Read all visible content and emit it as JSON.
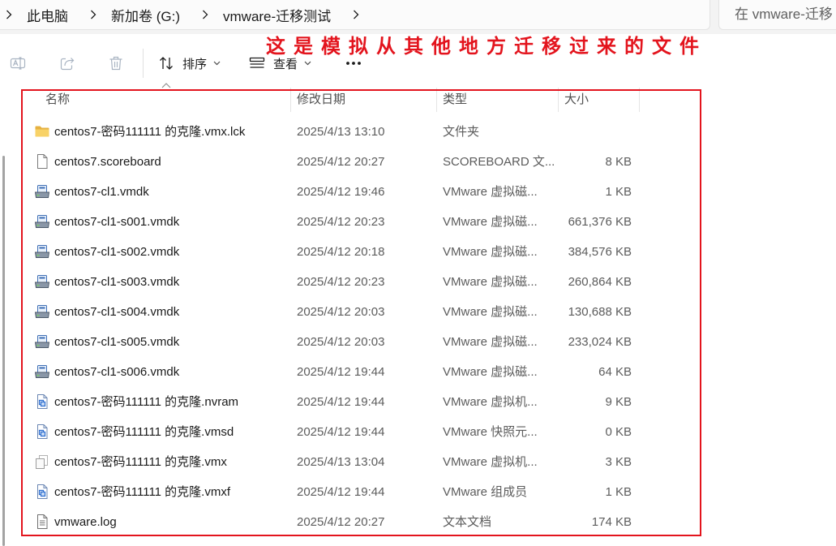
{
  "address_bar": {
    "crumbs": [
      "此电脑",
      "新加卷 (G:)",
      "vmware-迁移测试"
    ],
    "separator_icon": "chevron-right-icon"
  },
  "search": {
    "placeholder": "在 vmware-迁移"
  },
  "toolbar": {
    "rename": {
      "icon": "rename-icon",
      "disabled": true
    },
    "share": {
      "icon": "share-icon",
      "disabled": true
    },
    "delete": {
      "icon": "delete-icon",
      "disabled": true
    },
    "sort": {
      "icon": "sort-icon",
      "label": "排序",
      "dropdown_icon": "chevron-down-icon"
    },
    "view": {
      "icon": "view-list-icon",
      "label": "查看",
      "dropdown_icon": "chevron-down-icon"
    },
    "more": {
      "icon": "more-options-icon"
    }
  },
  "annotation": {
    "text": "这是模拟从其他地方迁移过来的文件",
    "color": "#e3141d",
    "box_color": "#e3141d"
  },
  "file_list": {
    "sort_indicator_icon": "chevron-up-icon",
    "columns": {
      "name": "名称",
      "modified": "修改日期",
      "type": "类型",
      "size": "大小"
    },
    "files": [
      {
        "icon": "folder-icon",
        "name": "centos7-密码111111 的克隆.vmx.lck",
        "modified": "2025/4/13 13:10",
        "type": "文件夹",
        "size": ""
      },
      {
        "icon": "document-icon",
        "name": "centos7.scoreboard",
        "modified": "2025/4/12 20:27",
        "type": "SCOREBOARD 文...",
        "size": "8 KB"
      },
      {
        "icon": "virtual-disk-icon",
        "name": "centos7-cl1.vmdk",
        "modified": "2025/4/12 19:46",
        "type": "VMware 虚拟磁...",
        "size": "1 KB"
      },
      {
        "icon": "virtual-disk-icon",
        "name": "centos7-cl1-s001.vmdk",
        "modified": "2025/4/12 20:23",
        "type": "VMware 虚拟磁...",
        "size": "661,376 KB"
      },
      {
        "icon": "virtual-disk-icon",
        "name": "centos7-cl1-s002.vmdk",
        "modified": "2025/4/12 20:18",
        "type": "VMware 虚拟磁...",
        "size": "384,576 KB"
      },
      {
        "icon": "virtual-disk-icon",
        "name": "centos7-cl1-s003.vmdk",
        "modified": "2025/4/12 20:23",
        "type": "VMware 虚拟磁...",
        "size": "260,864 KB"
      },
      {
        "icon": "virtual-disk-icon",
        "name": "centos7-cl1-s004.vmdk",
        "modified": "2025/4/12 20:03",
        "type": "VMware 虚拟磁...",
        "size": "130,688 KB"
      },
      {
        "icon": "virtual-disk-icon",
        "name": "centos7-cl1-s005.vmdk",
        "modified": "2025/4/12 20:03",
        "type": "VMware 虚拟磁...",
        "size": "233,024 KB"
      },
      {
        "icon": "virtual-disk-icon",
        "name": "centos7-cl1-s006.vmdk",
        "modified": "2025/4/12 19:44",
        "type": "VMware 虚拟磁...",
        "size": "64 KB"
      },
      {
        "icon": "vmware-document-icon",
        "name": "centos7-密码111111 的克隆.nvram",
        "modified": "2025/4/12 19:44",
        "type": "VMware 虚拟机...",
        "size": "9 KB"
      },
      {
        "icon": "vmware-document-icon",
        "name": "centos7-密码111111 的克隆.vmsd",
        "modified": "2025/4/12 19:44",
        "type": "VMware 快照元...",
        "size": "0 KB"
      },
      {
        "icon": "vmx-document-icon",
        "name": "centos7-密码111111 的克隆.vmx",
        "modified": "2025/4/13 13:04",
        "type": "VMware 虚拟机...",
        "size": "3 KB"
      },
      {
        "icon": "vmware-document-icon",
        "name": "centos7-密码111111 的克隆.vmxf",
        "modified": "2025/4/12 19:44",
        "type": "VMware 组成员",
        "size": "1 KB"
      },
      {
        "icon": "text-document-icon",
        "name": "vmware.log",
        "modified": "2025/4/12 20:27",
        "type": "文本文档",
        "size": "174 KB"
      }
    ]
  }
}
